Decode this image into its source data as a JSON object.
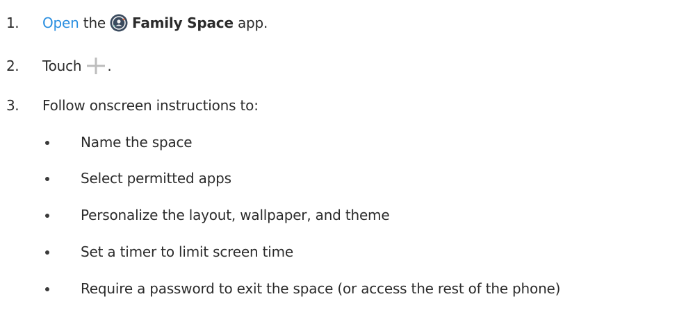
{
  "steps": [
    {
      "number": "1.",
      "link_text": "Open",
      "text_before_icon": "the",
      "icon": "family-space-app-icon",
      "bold_text": "Family Space",
      "text_after": "app."
    },
    {
      "number": "2.",
      "text_before_icon": "Touch",
      "icon": "plus-icon",
      "text_after": "."
    },
    {
      "number": "3.",
      "text": "Follow onscreen instructions to:"
    }
  ],
  "bullets": [
    "Name the space",
    "Select permitted apps",
    "Personalize the layout, wallpaper, and theme",
    "Set a timer to limit screen time",
    "Require a password to exit the space (or access the rest of the phone)"
  ],
  "colors": {
    "link": "#2b8fe0",
    "text": "#2b2b2b",
    "plus_icon": "#bdbdbd",
    "app_icon_bg": "#3a4a5e",
    "app_icon_accent": "#f2f2f2"
  }
}
